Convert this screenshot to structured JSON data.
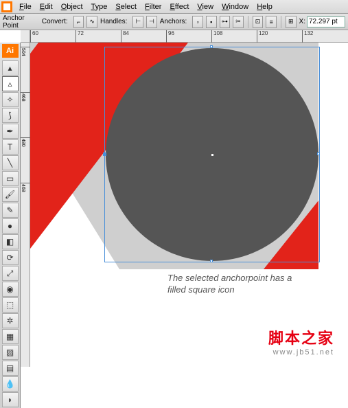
{
  "menu": {
    "items": [
      "File",
      "Edit",
      "Object",
      "Type",
      "Select",
      "Filter",
      "Effect",
      "View",
      "Window",
      "Help"
    ]
  },
  "controlbar": {
    "label": "Anchor Point",
    "convert_label": "Convert:",
    "handles_label": "Handles:",
    "anchors_label": "Anchors:",
    "x_label": "X:",
    "x_value": "72.297 pt"
  },
  "ruler_h": [
    "60",
    "72",
    "84",
    "96",
    "108",
    "120",
    "132"
  ],
  "ruler_v": [
    "504",
    "468",
    "480",
    "468"
  ],
  "tools": [
    {
      "name": "selection-tool",
      "glyph": "▴"
    },
    {
      "name": "direct-selection-tool",
      "glyph": "▵",
      "selected": true
    },
    {
      "name": "magic-wand-tool",
      "glyph": "✧"
    },
    {
      "name": "lasso-tool",
      "glyph": "⟆"
    },
    {
      "name": "pen-tool",
      "glyph": "✒"
    },
    {
      "name": "type-tool",
      "glyph": "T"
    },
    {
      "name": "line-tool",
      "glyph": "╲"
    },
    {
      "name": "rectangle-tool",
      "glyph": "▭"
    },
    {
      "name": "paintbrush-tool",
      "glyph": "🖌"
    },
    {
      "name": "pencil-tool",
      "glyph": "✎"
    },
    {
      "name": "blob-brush-tool",
      "glyph": "●"
    },
    {
      "name": "eraser-tool",
      "glyph": "◧"
    },
    {
      "name": "rotate-tool",
      "glyph": "⟳"
    },
    {
      "name": "scale-tool",
      "glyph": "⤢"
    },
    {
      "name": "warp-tool",
      "glyph": "◉"
    },
    {
      "name": "free-transform-tool",
      "glyph": "⬚"
    },
    {
      "name": "symbol-sprayer-tool",
      "glyph": "✲"
    },
    {
      "name": "graph-tool",
      "glyph": "▦"
    },
    {
      "name": "mesh-tool",
      "glyph": "▨"
    },
    {
      "name": "gradient-tool",
      "glyph": "▤"
    },
    {
      "name": "eyedropper-tool",
      "glyph": "💧"
    },
    {
      "name": "blend-tool",
      "glyph": "◗"
    }
  ],
  "caption": {
    "line1": "The selected anchorpoint has a",
    "line2": "filled square icon"
  },
  "watermark": {
    "cn": "脚本之家",
    "url": "www.jb51.net"
  },
  "colors": {
    "red": "#e2231a",
    "grey": "#cfcfcf",
    "circle": "#555555",
    "selection": "#4a90d9"
  }
}
